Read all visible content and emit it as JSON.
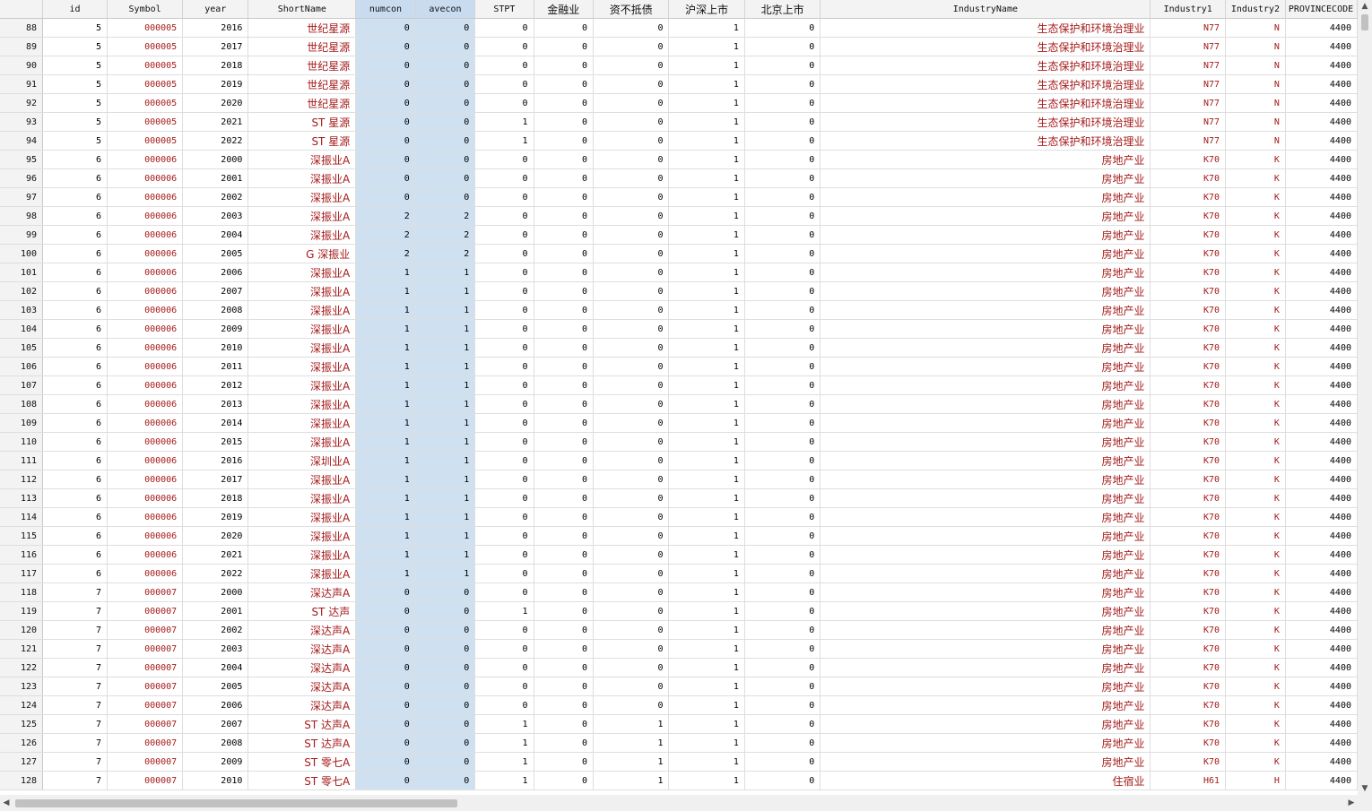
{
  "columns": [
    {
      "key": "rownum",
      "label": ""
    },
    {
      "key": "id",
      "label": "id"
    },
    {
      "key": "symbol",
      "label": "Symbol"
    },
    {
      "key": "year",
      "label": "year"
    },
    {
      "key": "shortname",
      "label": "ShortName"
    },
    {
      "key": "numcon",
      "label": "numcon"
    },
    {
      "key": "avecon",
      "label": "avecon"
    },
    {
      "key": "stpt",
      "label": "STPT"
    },
    {
      "key": "finance",
      "label": "金融业"
    },
    {
      "key": "insolvent",
      "label": "资不抵债"
    },
    {
      "key": "hushen",
      "label": "沪深上市"
    },
    {
      "key": "beijing",
      "label": "北京上市"
    },
    {
      "key": "industryname",
      "label": "IndustryName"
    },
    {
      "key": "industry1",
      "label": "Industry1"
    },
    {
      "key": "industry2",
      "label": "Industry2"
    },
    {
      "key": "province",
      "label": "PROVINCECODE"
    }
  ],
  "rows": [
    [
      "88",
      "5",
      "000005",
      "2016",
      "世纪星源",
      "0",
      "0",
      "0",
      "0",
      "0",
      "1",
      "0",
      "生态保护和环境治理业",
      "N77",
      "N",
      "4400"
    ],
    [
      "89",
      "5",
      "000005",
      "2017",
      "世纪星源",
      "0",
      "0",
      "0",
      "0",
      "0",
      "1",
      "0",
      "生态保护和环境治理业",
      "N77",
      "N",
      "4400"
    ],
    [
      "90",
      "5",
      "000005",
      "2018",
      "世纪星源",
      "0",
      "0",
      "0",
      "0",
      "0",
      "1",
      "0",
      "生态保护和环境治理业",
      "N77",
      "N",
      "4400"
    ],
    [
      "91",
      "5",
      "000005",
      "2019",
      "世纪星源",
      "0",
      "0",
      "0",
      "0",
      "0",
      "1",
      "0",
      "生态保护和环境治理业",
      "N77",
      "N",
      "4400"
    ],
    [
      "92",
      "5",
      "000005",
      "2020",
      "世纪星源",
      "0",
      "0",
      "0",
      "0",
      "0",
      "1",
      "0",
      "生态保护和环境治理业",
      "N77",
      "N",
      "4400"
    ],
    [
      "93",
      "5",
      "000005",
      "2021",
      "ST 星源",
      "0",
      "0",
      "1",
      "0",
      "0",
      "1",
      "0",
      "生态保护和环境治理业",
      "N77",
      "N",
      "4400"
    ],
    [
      "94",
      "5",
      "000005",
      "2022",
      "ST 星源",
      "0",
      "0",
      "1",
      "0",
      "0",
      "1",
      "0",
      "生态保护和环境治理业",
      "N77",
      "N",
      "4400"
    ],
    [
      "95",
      "6",
      "000006",
      "2000",
      "深振业A",
      "0",
      "0",
      "0",
      "0",
      "0",
      "1",
      "0",
      "房地产业",
      "K70",
      "K",
      "4400"
    ],
    [
      "96",
      "6",
      "000006",
      "2001",
      "深振业A",
      "0",
      "0",
      "0",
      "0",
      "0",
      "1",
      "0",
      "房地产业",
      "K70",
      "K",
      "4400"
    ],
    [
      "97",
      "6",
      "000006",
      "2002",
      "深振业A",
      "0",
      "0",
      "0",
      "0",
      "0",
      "1",
      "0",
      "房地产业",
      "K70",
      "K",
      "4400"
    ],
    [
      "98",
      "6",
      "000006",
      "2003",
      "深振业A",
      "2",
      "2",
      "0",
      "0",
      "0",
      "1",
      "0",
      "房地产业",
      "K70",
      "K",
      "4400"
    ],
    [
      "99",
      "6",
      "000006",
      "2004",
      "深振业A",
      "2",
      "2",
      "0",
      "0",
      "0",
      "1",
      "0",
      "房地产业",
      "K70",
      "K",
      "4400"
    ],
    [
      "100",
      "6",
      "000006",
      "2005",
      "G 深振业",
      "2",
      "2",
      "0",
      "0",
      "0",
      "1",
      "0",
      "房地产业",
      "K70",
      "K",
      "4400"
    ],
    [
      "101",
      "6",
      "000006",
      "2006",
      "深振业A",
      "1",
      "1",
      "0",
      "0",
      "0",
      "1",
      "0",
      "房地产业",
      "K70",
      "K",
      "4400"
    ],
    [
      "102",
      "6",
      "000006",
      "2007",
      "深振业A",
      "1",
      "1",
      "0",
      "0",
      "0",
      "1",
      "0",
      "房地产业",
      "K70",
      "K",
      "4400"
    ],
    [
      "103",
      "6",
      "000006",
      "2008",
      "深振业A",
      "1",
      "1",
      "0",
      "0",
      "0",
      "1",
      "0",
      "房地产业",
      "K70",
      "K",
      "4400"
    ],
    [
      "104",
      "6",
      "000006",
      "2009",
      "深振业A",
      "1",
      "1",
      "0",
      "0",
      "0",
      "1",
      "0",
      "房地产业",
      "K70",
      "K",
      "4400"
    ],
    [
      "105",
      "6",
      "000006",
      "2010",
      "深振业A",
      "1",
      "1",
      "0",
      "0",
      "0",
      "1",
      "0",
      "房地产业",
      "K70",
      "K",
      "4400"
    ],
    [
      "106",
      "6",
      "000006",
      "2011",
      "深振业A",
      "1",
      "1",
      "0",
      "0",
      "0",
      "1",
      "0",
      "房地产业",
      "K70",
      "K",
      "4400"
    ],
    [
      "107",
      "6",
      "000006",
      "2012",
      "深振业A",
      "1",
      "1",
      "0",
      "0",
      "0",
      "1",
      "0",
      "房地产业",
      "K70",
      "K",
      "4400"
    ],
    [
      "108",
      "6",
      "000006",
      "2013",
      "深振业A",
      "1",
      "1",
      "0",
      "0",
      "0",
      "1",
      "0",
      "房地产业",
      "K70",
      "K",
      "4400"
    ],
    [
      "109",
      "6",
      "000006",
      "2014",
      "深振业A",
      "1",
      "1",
      "0",
      "0",
      "0",
      "1",
      "0",
      "房地产业",
      "K70",
      "K",
      "4400"
    ],
    [
      "110",
      "6",
      "000006",
      "2015",
      "深振业A",
      "1",
      "1",
      "0",
      "0",
      "0",
      "1",
      "0",
      "房地产业",
      "K70",
      "K",
      "4400"
    ],
    [
      "111",
      "6",
      "000006",
      "2016",
      "深圳业A",
      "1",
      "1",
      "0",
      "0",
      "0",
      "1",
      "0",
      "房地产业",
      "K70",
      "K",
      "4400"
    ],
    [
      "112",
      "6",
      "000006",
      "2017",
      "深振业A",
      "1",
      "1",
      "0",
      "0",
      "0",
      "1",
      "0",
      "房地产业",
      "K70",
      "K",
      "4400"
    ],
    [
      "113",
      "6",
      "000006",
      "2018",
      "深振业A",
      "1",
      "1",
      "0",
      "0",
      "0",
      "1",
      "0",
      "房地产业",
      "K70",
      "K",
      "4400"
    ],
    [
      "114",
      "6",
      "000006",
      "2019",
      "深振业A",
      "1",
      "1",
      "0",
      "0",
      "0",
      "1",
      "0",
      "房地产业",
      "K70",
      "K",
      "4400"
    ],
    [
      "115",
      "6",
      "000006",
      "2020",
      "深振业A",
      "1",
      "1",
      "0",
      "0",
      "0",
      "1",
      "0",
      "房地产业",
      "K70",
      "K",
      "4400"
    ],
    [
      "116",
      "6",
      "000006",
      "2021",
      "深振业A",
      "1",
      "1",
      "0",
      "0",
      "0",
      "1",
      "0",
      "房地产业",
      "K70",
      "K",
      "4400"
    ],
    [
      "117",
      "6",
      "000006",
      "2022",
      "深振业A",
      "1",
      "1",
      "0",
      "0",
      "0",
      "1",
      "0",
      "房地产业",
      "K70",
      "K",
      "4400"
    ],
    [
      "118",
      "7",
      "000007",
      "2000",
      "深达声A",
      "0",
      "0",
      "0",
      "0",
      "0",
      "1",
      "0",
      "房地产业",
      "K70",
      "K",
      "4400"
    ],
    [
      "119",
      "7",
      "000007",
      "2001",
      "ST 达声",
      "0",
      "0",
      "1",
      "0",
      "0",
      "1",
      "0",
      "房地产业",
      "K70",
      "K",
      "4400"
    ],
    [
      "120",
      "7",
      "000007",
      "2002",
      "深达声A",
      "0",
      "0",
      "0",
      "0",
      "0",
      "1",
      "0",
      "房地产业",
      "K70",
      "K",
      "4400"
    ],
    [
      "121",
      "7",
      "000007",
      "2003",
      "深达声A",
      "0",
      "0",
      "0",
      "0",
      "0",
      "1",
      "0",
      "房地产业",
      "K70",
      "K",
      "4400"
    ],
    [
      "122",
      "7",
      "000007",
      "2004",
      "深达声A",
      "0",
      "0",
      "0",
      "0",
      "0",
      "1",
      "0",
      "房地产业",
      "K70",
      "K",
      "4400"
    ],
    [
      "123",
      "7",
      "000007",
      "2005",
      "深达声A",
      "0",
      "0",
      "0",
      "0",
      "0",
      "1",
      "0",
      "房地产业",
      "K70",
      "K",
      "4400"
    ],
    [
      "124",
      "7",
      "000007",
      "2006",
      "深达声A",
      "0",
      "0",
      "0",
      "0",
      "0",
      "1",
      "0",
      "房地产业",
      "K70",
      "K",
      "4400"
    ],
    [
      "125",
      "7",
      "000007",
      "2007",
      "ST 达声A",
      "0",
      "0",
      "1",
      "0",
      "1",
      "1",
      "0",
      "房地产业",
      "K70",
      "K",
      "4400"
    ],
    [
      "126",
      "7",
      "000007",
      "2008",
      "ST 达声A",
      "0",
      "0",
      "1",
      "0",
      "1",
      "1",
      "0",
      "房地产业",
      "K70",
      "K",
      "4400"
    ],
    [
      "127",
      "7",
      "000007",
      "2009",
      "ST 零七A",
      "0",
      "0",
      "1",
      "0",
      "1",
      "1",
      "0",
      "房地产业",
      "K70",
      "K",
      "4400"
    ],
    [
      "128",
      "7",
      "000007",
      "2010",
      "ST 零七A",
      "0",
      "0",
      "1",
      "0",
      "1",
      "1",
      "0",
      "住宿业",
      "H61",
      "H",
      "4400"
    ]
  ],
  "scrollbars": {
    "up": "▲",
    "down": "▼",
    "left": "◀",
    "right": "▶"
  },
  "colors": {
    "string_text": "#a61b1b",
    "selected_column": "#cfe0f0",
    "header_bg": "#f3f3f3"
  }
}
